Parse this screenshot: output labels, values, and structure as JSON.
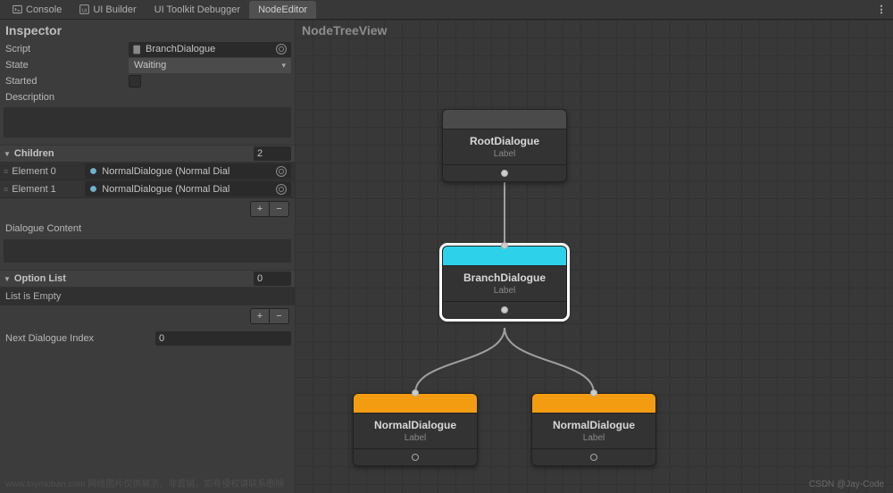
{
  "tabs": {
    "console": "Console",
    "ui_builder": "UI Builder",
    "debugger": "UI Toolkit Debugger",
    "node_editor": "NodeEditor"
  },
  "inspector": {
    "title": "Inspector",
    "script": {
      "label": "Script",
      "value": "BranchDialogue"
    },
    "state": {
      "label": "State",
      "value": "Waiting"
    },
    "started": {
      "label": "Started"
    },
    "description": {
      "label": "Description"
    },
    "children": {
      "title": "Children",
      "count": "2",
      "items": [
        {
          "label": "Element 0",
          "value": "NormalDialogue (Normal Dial"
        },
        {
          "label": "Element 1",
          "value": "NormalDialogue (Normal Dial"
        }
      ],
      "add": "+",
      "remove": "−"
    },
    "dialogue_content": {
      "label": "Dialogue Content"
    },
    "option_list": {
      "title": "Option List",
      "count": "0",
      "empty": "List is Empty",
      "add": "+",
      "remove": "−"
    },
    "next_index": {
      "label": "Next Dialogue Index",
      "value": "0"
    }
  },
  "canvas": {
    "title": "NodeTreeView",
    "label_text": "Label",
    "nodes": {
      "root": "RootDialogue",
      "branch": "BranchDialogue",
      "normal_a": "NormalDialogue",
      "normal_b": "NormalDialogue"
    }
  },
  "footer": {
    "watermark": "www.toymoban.com 网络图片仅供展示，非首销，如有侵权请联系删除",
    "credit": "CSDN @Jay-Code"
  }
}
